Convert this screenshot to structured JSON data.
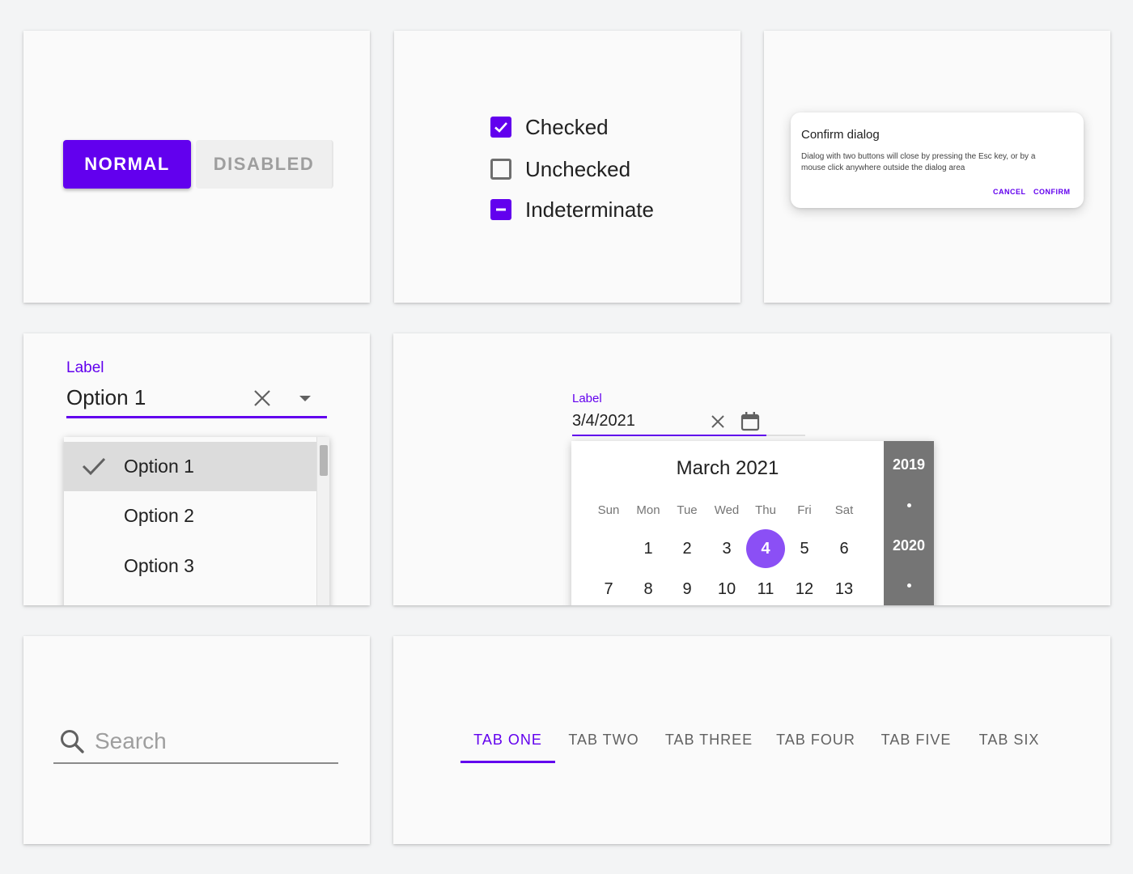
{
  "colors": {
    "primary": "#6200ee",
    "primary_light": "#8b4ff5",
    "disabled_bg": "#efefef",
    "disabled_text": "#9e9e9e",
    "year_panel": "#757575"
  },
  "buttons": {
    "normal_label": "NORMAL",
    "disabled_label": "DISABLED"
  },
  "checkboxes": [
    {
      "label": "Checked",
      "state": "checked"
    },
    {
      "label": "Unchecked",
      "state": "unchecked"
    },
    {
      "label": "Indeterminate",
      "state": "indeterminate"
    }
  ],
  "dialog": {
    "title": "Confirm dialog",
    "body": "Dialog with two buttons will close by pressing the Esc key, or by a mouse click anywhere outside the dialog area",
    "cancel_label": "CANCEL",
    "confirm_label": "CONFIRM"
  },
  "select": {
    "label": "Label",
    "value": "Option 1",
    "options": [
      "Option 1",
      "Option 2",
      "Option 3"
    ],
    "selected_index": 0
  },
  "datepicker": {
    "label": "Label",
    "value": "3/4/2021",
    "month_title": "March 2021",
    "weekdays": [
      "Sun",
      "Mon",
      "Tue",
      "Wed",
      "Thu",
      "Fri",
      "Sat"
    ],
    "week1": [
      "",
      "1",
      "2",
      "3",
      "4",
      "5",
      "6"
    ],
    "week2": [
      "7",
      "8",
      "9",
      "10",
      "11",
      "12",
      "13"
    ],
    "selected_day": "4",
    "years": [
      "2019",
      "2020"
    ]
  },
  "search": {
    "placeholder": "Search"
  },
  "tabs": {
    "items": [
      "TAB ONE",
      "TAB TWO",
      "TAB THREE",
      "TAB FOUR",
      "TAB FIVE",
      "TAB SIX"
    ],
    "active_index": 0
  }
}
